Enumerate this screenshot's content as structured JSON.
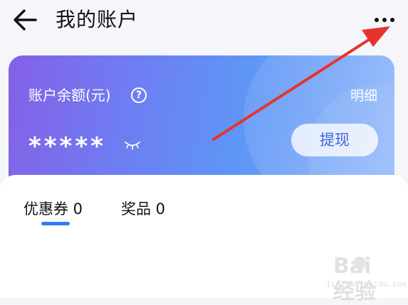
{
  "header": {
    "title": "我的账户",
    "back_icon": "arrow-left-icon",
    "more_icon": "more-horizontal-icon"
  },
  "balance_card": {
    "label": "账户余额(元)",
    "help_icon": "question-circle-icon",
    "help_glyph": "?",
    "detail_link": "明细",
    "masked_value": "*****",
    "visibility_icon": "eye-closed-icon",
    "withdraw_button": "提现",
    "gradient_colors": [
      "#8560e6",
      "#5e96f6",
      "#8fb7fb"
    ]
  },
  "tabs": [
    {
      "label": "优惠券 0",
      "active": true
    },
    {
      "label": "奖品 0",
      "active": false
    }
  ],
  "colors": {
    "accent": "#2f7df6",
    "annotation_arrow": "#e8322e",
    "withdraw_text": "#3d63d6"
  },
  "watermark": {
    "logo_text": "Bai  经验",
    "sub_text": "jingyan.baidu.com"
  }
}
